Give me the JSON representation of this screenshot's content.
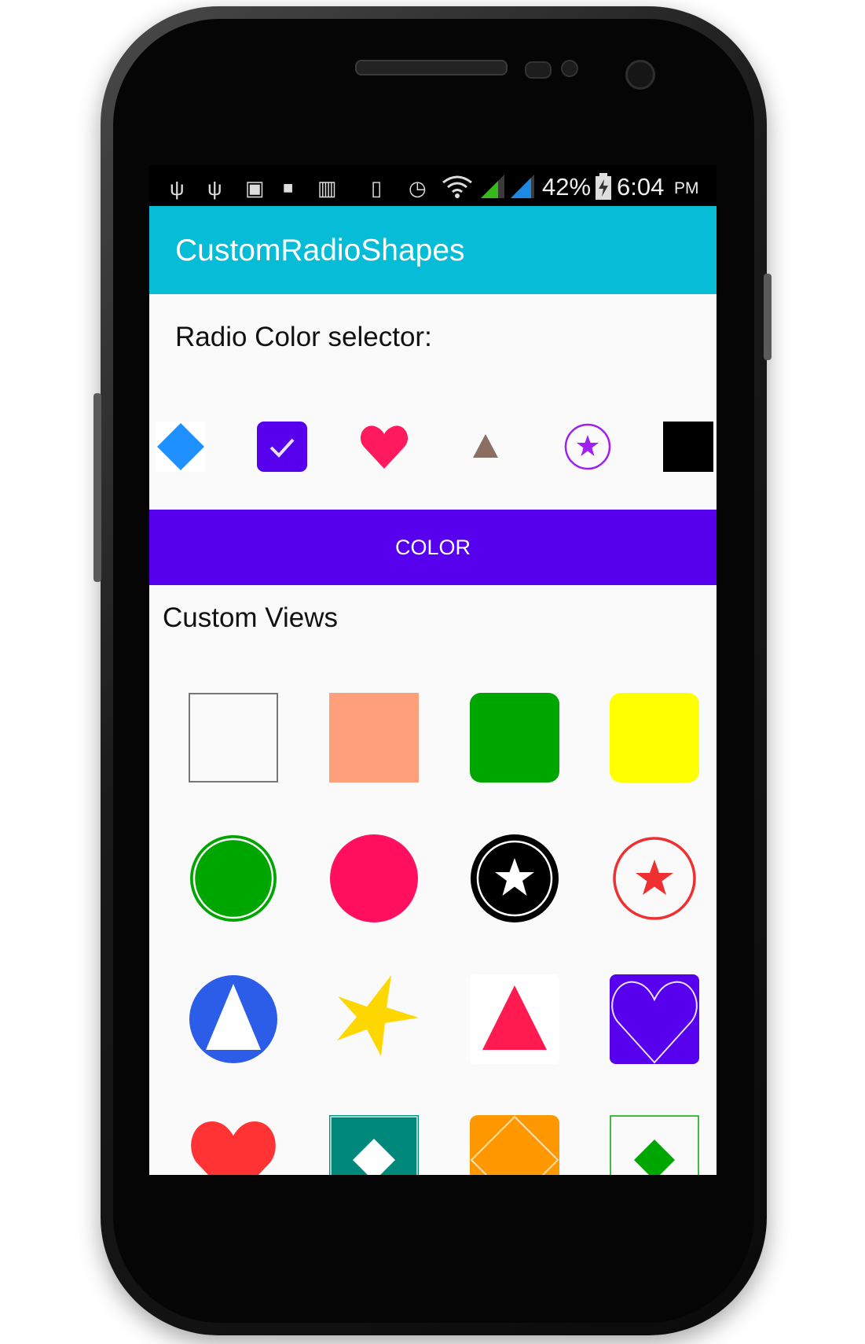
{
  "status_bar": {
    "battery_percent": "42%",
    "time": "6:04",
    "ampm": "PM",
    "icons": [
      "usb-icon",
      "usb-icon",
      "sd-card-icon",
      "lock-icon",
      "barcode-icon",
      "vibrate-icon",
      "alarm-icon",
      "wifi-icon",
      "signal-icon",
      "signal-icon",
      "battery-charging-icon"
    ]
  },
  "app": {
    "title": "CustomRadioShapes"
  },
  "radio_section": {
    "label": "Radio Color selector:",
    "items": [
      {
        "shape": "diamond",
        "color": "#1e90ff"
      },
      {
        "shape": "checked-square",
        "color": "#5600ee"
      },
      {
        "shape": "heart",
        "color": "#ff1a5e"
      },
      {
        "shape": "triangle",
        "color": "#8d6e63"
      },
      {
        "shape": "star-in-circle",
        "color": "#a020f0"
      },
      {
        "shape": "square",
        "color": "#000000"
      }
    ]
  },
  "color_button": {
    "label": "COLOR",
    "color": "#5600ee"
  },
  "custom_views": {
    "label": "Custom Views",
    "items": [
      {
        "shape": "outline-square",
        "color": "#777777"
      },
      {
        "shape": "square",
        "color": "#ffa07a"
      },
      {
        "shape": "rounded-square",
        "color": "#00a600"
      },
      {
        "shape": "rounded-square",
        "color": "#ffff00"
      },
      {
        "shape": "ring-circle",
        "color": "#00a600"
      },
      {
        "shape": "circle",
        "color": "#ff0f5e"
      },
      {
        "shape": "star-in-black-circle",
        "color": "#000000"
      },
      {
        "shape": "star-in-outline-circle",
        "color": "#f03030"
      },
      {
        "shape": "triangle-in-circle",
        "color": "#2b5de8"
      },
      {
        "shape": "star",
        "color": "#ffd700"
      },
      {
        "shape": "triangle-on-white",
        "color": "#ff1a4f"
      },
      {
        "shape": "heart-on-square",
        "color": "#5600ee"
      },
      {
        "shape": "heart",
        "color": "#ff3333"
      },
      {
        "shape": "diamond-on-square",
        "color": "#00897b"
      },
      {
        "shape": "diamond-outline-on-square",
        "color": "#ff9800"
      },
      {
        "shape": "diamond-in-outline-square",
        "color": "#00a600"
      }
    ]
  }
}
